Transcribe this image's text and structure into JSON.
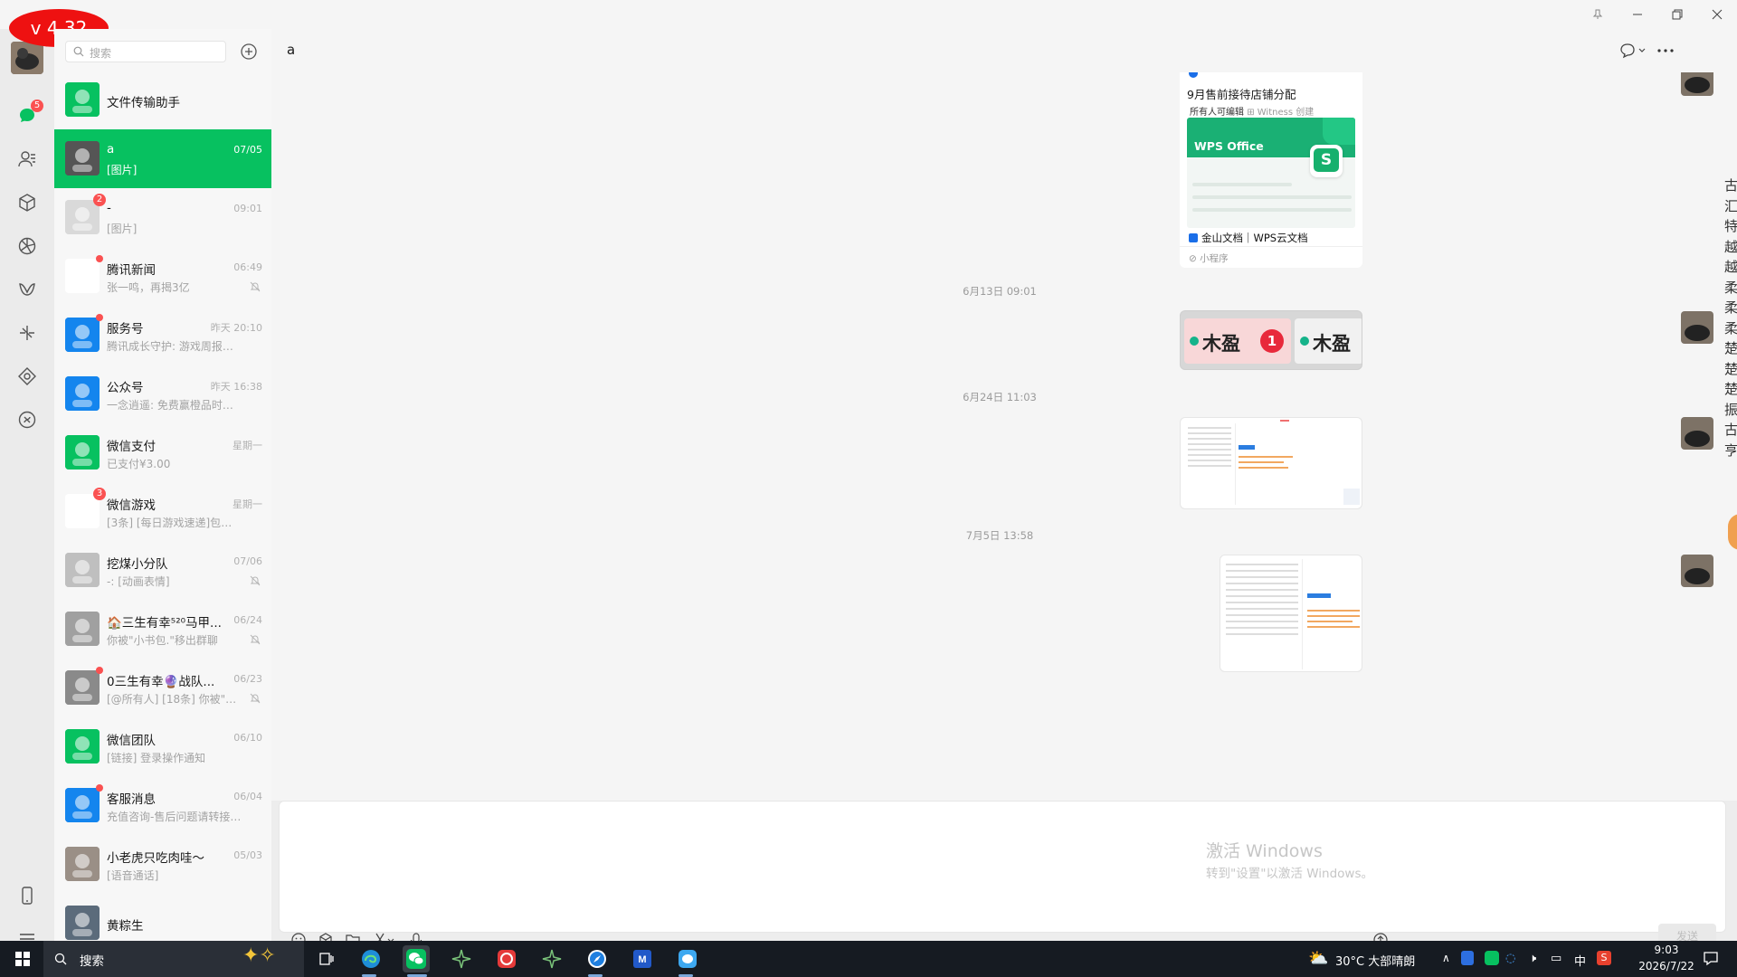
{
  "version_badge": "v 4.32",
  "search": {
    "placeholder": "搜索"
  },
  "nav": {
    "chat_badge": "5"
  },
  "chats": [
    {
      "name": "文件传输助手",
      "time": "",
      "msg": "",
      "avatar_color": "#07c160",
      "badge": "",
      "dot": false,
      "muted": false
    },
    {
      "name": "a",
      "time": "07/05",
      "msg": "[图片]",
      "avatar_color": "#555555",
      "badge": "",
      "dot": false,
      "muted": false,
      "active": true
    },
    {
      "name": "-",
      "time": "09:01",
      "msg": "[图片]",
      "avatar_color": "#d9d9d9",
      "badge": "2",
      "dot": false,
      "muted": false
    },
    {
      "name": "腾讯新闻",
      "time": "06:49",
      "msg": "张一鸣，再揭3亿",
      "avatar_color": "#ffffff",
      "badge": "",
      "dot": true,
      "muted": true
    },
    {
      "name": "服务号",
      "time": "昨天 20:10",
      "msg": "腾讯成长守护: 游戏周报生成...",
      "avatar_color": "#1485ee",
      "badge": "",
      "dot": true,
      "muted": false
    },
    {
      "name": "公众号",
      "time": "昨天 16:38",
      "msg": "一念逍遥: 免费赢橙品时装机...",
      "avatar_color": "#1485ee",
      "badge": "",
      "dot": false,
      "muted": false
    },
    {
      "name": "微信支付",
      "time": "星期一",
      "msg": "已支付¥3.00",
      "avatar_color": "#07c160",
      "badge": "",
      "dot": false,
      "muted": false
    },
    {
      "name": "微信游戏",
      "time": "星期一",
      "msg": "[3条] [每日游戏速递]包上头的...",
      "avatar_color": "#ffffff",
      "badge": "3",
      "dot": false,
      "muted": false
    },
    {
      "name": "挖煤小分队",
      "time": "07/06",
      "msg": "-: [动画表情]",
      "avatar_color": "#bfbfbf",
      "badge": "",
      "dot": false,
      "muted": true
    },
    {
      "name": "🏠三生有幸⁵²⁰马甲...",
      "time": "06/24",
      "msg": "你被\"小书包.\"移出群聊",
      "avatar_color": "#a0a0a0",
      "badge": "",
      "dot": false,
      "muted": true
    },
    {
      "name": "0三生有幸🔮战队...",
      "time": "06/23",
      "msg": "[@所有人] [18条] 你被\"Ac...",
      "avatar_color": "#8a8a8a",
      "badge": "",
      "dot": true,
      "muted": true
    },
    {
      "name": "微信团队",
      "time": "06/10",
      "msg": "[链接] 登录操作通知",
      "avatar_color": "#07c160",
      "badge": "",
      "dot": false,
      "muted": false
    },
    {
      "name": "客服消息",
      "time": "06/04",
      "msg": "充值咨询-售后问题请转接售后...",
      "avatar_color": "#1485ee",
      "badge": "",
      "dot": true,
      "muted": false
    },
    {
      "name": "小老虎只吃肉哇～",
      "time": "05/03",
      "msg": "[语音通话]",
      "avatar_color": "#9a8f86",
      "badge": "",
      "dot": false,
      "muted": false
    },
    {
      "name": "黄粽生",
      "time": "",
      "msg": "",
      "avatar_color": "#5b6b7b",
      "badge": "",
      "dot": false,
      "muted": false
    }
  ],
  "chat": {
    "title": "a",
    "card": {
      "title": "9月售前接待店铺分配",
      "meta_edit": "所有人可编辑",
      "meta_creator": "Witness",
      "meta_action": "创建",
      "banner": "WPS Office",
      "banner_icon": "S",
      "source": "金山文档｜WPS云文档",
      "footer": "小程序"
    },
    "timestamps": [
      "6月13日 09:01",
      "6月24日 11:03",
      "7月5日 13:58"
    ],
    "mujiu_text": "木盈",
    "mujiu_badge": "1",
    "send_label": "发送",
    "watermark_title": "激活 Windows",
    "watermark_sub": "转到\"设置\"以激活 Windows。"
  },
  "right_edge_chars": [
    "古",
    "汇",
    "特",
    "越",
    "越",
    "柔",
    "柔",
    "柔",
    "楚",
    "楚",
    "楚",
    "振",
    "古",
    "亨"
  ],
  "taskbar": {
    "search_label": "搜索",
    "weather": "30°C  大部晴朗",
    "ime": "中",
    "time": "9:03",
    "date": "2026/7/22"
  },
  "colors": {
    "accent": "#07c160",
    "badge": "#fa5151",
    "taskbar": "#161b22"
  }
}
